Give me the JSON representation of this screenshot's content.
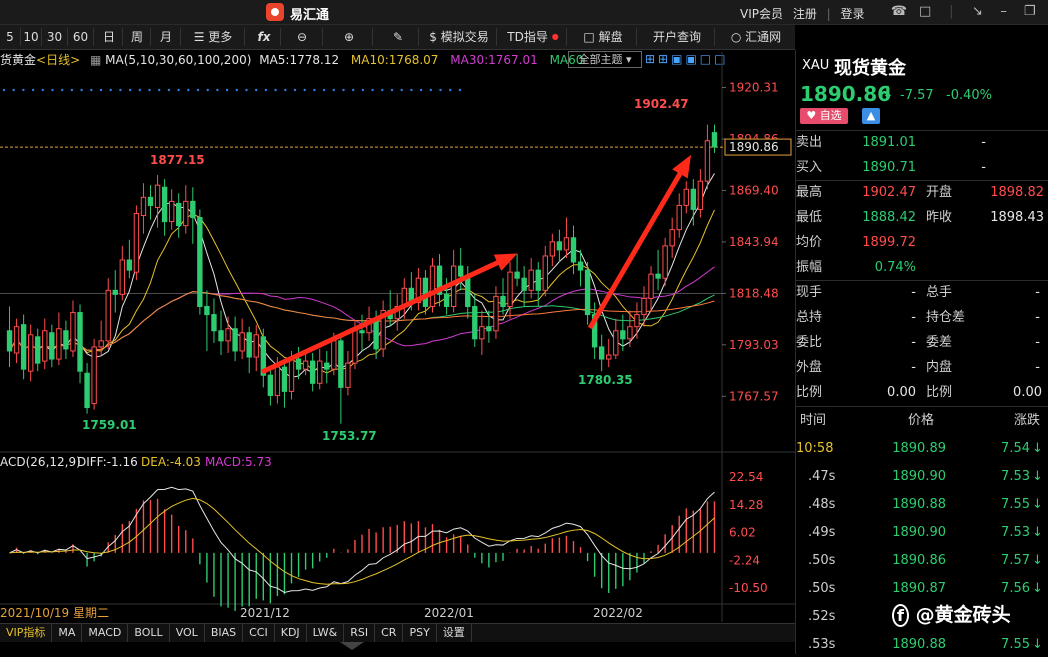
{
  "app": {
    "title": "易汇通",
    "top_links": [
      "VIP会员",
      "注册",
      "登录"
    ]
  },
  "toolbar": {
    "periods": [
      "5",
      "10",
      "30",
      "60",
      "日",
      "周",
      "月"
    ],
    "more": "更多",
    "fx": "fx",
    "drawing": "",
    "simtrade": "$ 模拟交易",
    "td": "TD指导",
    "jiepan": "解盘",
    "account": "开户查询",
    "huihui": "汇通网"
  },
  "chart_info": {
    "symbol": "货黄金",
    "period": "<日线>",
    "ma_label": "MA(5,10,30,60,100,200)",
    "ma5": "MA5:1778.12",
    "ma10": "MA10:1768.07",
    "ma30": "MA30:1767.01",
    "ma60": "MA60",
    "theme": "全部主题"
  },
  "quote": {
    "code": "XAU",
    "name": "现货黄金",
    "price": "1890.86",
    "change": "-7.57",
    "pct": "-0.40%",
    "fav": "自选",
    "sell_label": "卖出",
    "sell": "1891.01",
    "sell_vol": "-",
    "buy_label": "买入",
    "buy": "1890.71",
    "buy_vol": "-",
    "high_label": "最高",
    "high": "1902.47",
    "open_label": "开盘",
    "open": "1898.82",
    "low_label": "最低",
    "low": "1888.42",
    "prev_label": "昨收",
    "prev": "1898.43",
    "avg_label": "均价",
    "avg": "1899.72",
    "amp_label": "振幅",
    "amp": "0.74%",
    "now_hand": "现手",
    "total_hand": "总手",
    "hold": "总持",
    "hold_diff": "持仓差",
    "wei_bi": "委比",
    "wei_cha": "委差",
    "out": "外盘",
    "in": "内盘",
    "ratio": "比例",
    "ratio_val1": "0.00",
    "ratio2": "比例",
    "ratio_val2": "0.00",
    "dash": "-"
  },
  "ticks": {
    "headers": [
      "时间",
      "价格",
      "涨跌"
    ],
    "rows": [
      {
        "time": "10:58",
        "price": "1890.89",
        "chg": "7.54"
      },
      {
        "time": ".47s",
        "price": "1890.90",
        "chg": "7.53"
      },
      {
        "time": ".48s",
        "price": "1890.88",
        "chg": "7.55"
      },
      {
        "time": ".49s",
        "price": "1890.90",
        "chg": "7.53"
      },
      {
        "time": ".50s",
        "price": "1890.86",
        "chg": "7.57"
      },
      {
        "time": ".50s",
        "price": "1890.87",
        "chg": "7.56"
      },
      {
        "time": ".52s",
        "price": "",
        "chg": ""
      },
      {
        "time": ".53s",
        "price": "1890.88",
        "chg": "7.55"
      }
    ],
    "watermark": "@黄金砖头"
  },
  "bottom_tabs": [
    "VIP指标",
    "MA",
    "MACD",
    "BOLL",
    "VOL",
    "BIAS",
    "CCI",
    "KDJ",
    "LW&",
    "RSI",
    "CR",
    "PSY",
    "设置"
  ],
  "colors": {
    "up": "#ff4d4d",
    "down": "#2ecc71",
    "arrow": "#ff2a1a"
  },
  "chart_data": {
    "type": "candlestick",
    "title": "",
    "ylim": [
      1742,
      1928
    ],
    "y_ticks": [
      1920.31,
      1894.86,
      1869.4,
      1843.94,
      1818.48,
      1793.03,
      1767.57
    ],
    "x_labels": [
      "2021/10/19 星期二",
      "2021/12",
      "2022/01",
      "2022/02"
    ],
    "current_price": "1890.86",
    "annotations": [
      {
        "label": "1877.15",
        "value": 1877.15
      },
      {
        "label": "1759.01",
        "value": 1759.01
      },
      {
        "label": "1753.77",
        "value": 1753.77
      },
      {
        "label": "1780.35",
        "value": 1780.35
      },
      {
        "label": "1902.47",
        "value": 1902.47
      }
    ],
    "candles": [
      [
        1800,
        1790,
        1812,
        1782
      ],
      [
        1789,
        1802,
        1806,
        1784
      ],
      [
        1803,
        1781,
        1808,
        1776
      ],
      [
        1780,
        1798,
        1803,
        1775
      ],
      [
        1797,
        1784,
        1801,
        1780
      ],
      [
        1785,
        1800,
        1806,
        1781
      ],
      [
        1799,
        1786,
        1803,
        1782
      ],
      [
        1786,
        1801,
        1809,
        1783
      ],
      [
        1800,
        1791,
        1805,
        1786
      ],
      [
        1790,
        1809,
        1815,
        1787
      ],
      [
        1809,
        1780,
        1813,
        1774
      ],
      [
        1779,
        1762,
        1784,
        1759
      ],
      [
        1764,
        1792,
        1796,
        1761
      ],
      [
        1792,
        1795,
        1805,
        1788
      ],
      [
        1795,
        1820,
        1826,
        1791
      ],
      [
        1820,
        1818,
        1830,
        1809
      ],
      [
        1818,
        1835,
        1842,
        1815
      ],
      [
        1835,
        1830,
        1845,
        1826
      ],
      [
        1829,
        1858,
        1862,
        1825
      ],
      [
        1857,
        1866,
        1873,
        1848
      ],
      [
        1866,
        1862,
        1872,
        1855
      ],
      [
        1861,
        1872,
        1877,
        1851
      ],
      [
        1871,
        1854,
        1875,
        1847
      ],
      [
        1854,
        1864,
        1870,
        1850
      ],
      [
        1863,
        1852,
        1868,
        1846
      ],
      [
        1852,
        1864,
        1872,
        1848
      ],
      [
        1864,
        1856,
        1871,
        1843
      ],
      [
        1856,
        1812,
        1860,
        1808
      ],
      [
        1812,
        1808,
        1820,
        1790
      ],
      [
        1808,
        1800,
        1816,
        1794
      ],
      [
        1800,
        1795,
        1810,
        1788
      ],
      [
        1795,
        1801,
        1807,
        1789
      ],
      [
        1801,
        1790,
        1807,
        1785
      ],
      [
        1790,
        1799,
        1806,
        1786
      ],
      [
        1799,
        1787,
        1802,
        1779
      ],
      [
        1787,
        1798,
        1803,
        1780
      ],
      [
        1797,
        1778,
        1801,
        1772
      ],
      [
        1778,
        1768,
        1782,
        1763
      ],
      [
        1768,
        1782,
        1787,
        1764
      ],
      [
        1782,
        1770,
        1785,
        1762
      ],
      [
        1770,
        1787,
        1790,
        1766
      ],
      [
        1786,
        1781,
        1792,
        1776
      ],
      [
        1781,
        1785,
        1790,
        1778
      ],
      [
        1785,
        1774,
        1789,
        1770
      ],
      [
        1774,
        1785,
        1791,
        1771
      ],
      [
        1784,
        1781,
        1790,
        1774
      ],
      [
        1781,
        1795,
        1799,
        1778
      ],
      [
        1795,
        1772,
        1798,
        1754
      ],
      [
        1772,
        1784,
        1790,
        1768
      ],
      [
        1784,
        1800,
        1805,
        1781
      ],
      [
        1800,
        1799,
        1808,
        1790
      ],
      [
        1799,
        1806,
        1812,
        1795
      ],
      [
        1806,
        1791,
        1810,
        1786
      ],
      [
        1791,
        1810,
        1815,
        1787
      ],
      [
        1810,
        1806,
        1820,
        1802
      ],
      [
        1806,
        1812,
        1818,
        1800
      ],
      [
        1812,
        1821,
        1826,
        1806
      ],
      [
        1821,
        1814,
        1829,
        1810
      ],
      [
        1814,
        1826,
        1831,
        1810
      ],
      [
        1826,
        1812,
        1830,
        1808
      ],
      [
        1812,
        1832,
        1836,
        1809
      ],
      [
        1832,
        1818,
        1838,
        1812
      ],
      [
        1818,
        1812,
        1826,
        1808
      ],
      [
        1812,
        1832,
        1840,
        1809
      ],
      [
        1832,
        1827,
        1841,
        1820
      ],
      [
        1827,
        1812,
        1832,
        1806
      ],
      [
        1812,
        1796,
        1818,
        1792
      ],
      [
        1796,
        1802,
        1810,
        1788
      ],
      [
        1802,
        1800,
        1810,
        1794
      ],
      [
        1800,
        1817,
        1822,
        1796
      ],
      [
        1817,
        1812,
        1826,
        1808
      ],
      [
        1812,
        1829,
        1834,
        1806
      ],
      [
        1829,
        1826,
        1838,
        1822
      ],
      [
        1826,
        1820,
        1832,
        1812
      ],
      [
        1820,
        1830,
        1836,
        1816
      ],
      [
        1830,
        1820,
        1834,
        1812
      ],
      [
        1820,
        1837,
        1842,
        1817
      ],
      [
        1837,
        1844,
        1848,
        1832
      ],
      [
        1844,
        1840,
        1850,
        1834
      ],
      [
        1840,
        1846,
        1856,
        1836
      ],
      [
        1846,
        1834,
        1852,
        1828
      ],
      [
        1834,
        1830,
        1840,
        1822
      ],
      [
        1830,
        1808,
        1834,
        1803
      ],
      [
        1808,
        1792,
        1814,
        1786
      ],
      [
        1792,
        1786,
        1798,
        1780
      ],
      [
        1786,
        1788,
        1796,
        1782
      ],
      [
        1788,
        1800,
        1806,
        1786
      ],
      [
        1800,
        1796,
        1808,
        1790
      ],
      [
        1796,
        1802,
        1810,
        1792
      ],
      [
        1802,
        1808,
        1814,
        1796
      ],
      [
        1808,
        1816,
        1822,
        1802
      ],
      [
        1816,
        1828,
        1832,
        1810
      ],
      [
        1828,
        1826,
        1840,
        1820
      ],
      [
        1826,
        1842,
        1846,
        1822
      ],
      [
        1842,
        1850,
        1856,
        1836
      ],
      [
        1850,
        1862,
        1868,
        1846
      ],
      [
        1862,
        1870,
        1874,
        1858
      ],
      [
        1870,
        1860,
        1875,
        1852
      ],
      [
        1860,
        1874,
        1880,
        1856
      ],
      [
        1874,
        1894,
        1902,
        1870
      ],
      [
        1898,
        1891,
        1902,
        1888
      ]
    ],
    "macd": {
      "label": "ACD(26,12,9)",
      "diff": "DIFF:-1.16",
      "dea": "DEA:-4.03",
      "macd": "MACD:5.73",
      "ylim": [
        -14,
        27
      ],
      "y_ticks": [
        22.54,
        14.28,
        6.02,
        -2.24,
        -10.5
      ]
    }
  }
}
